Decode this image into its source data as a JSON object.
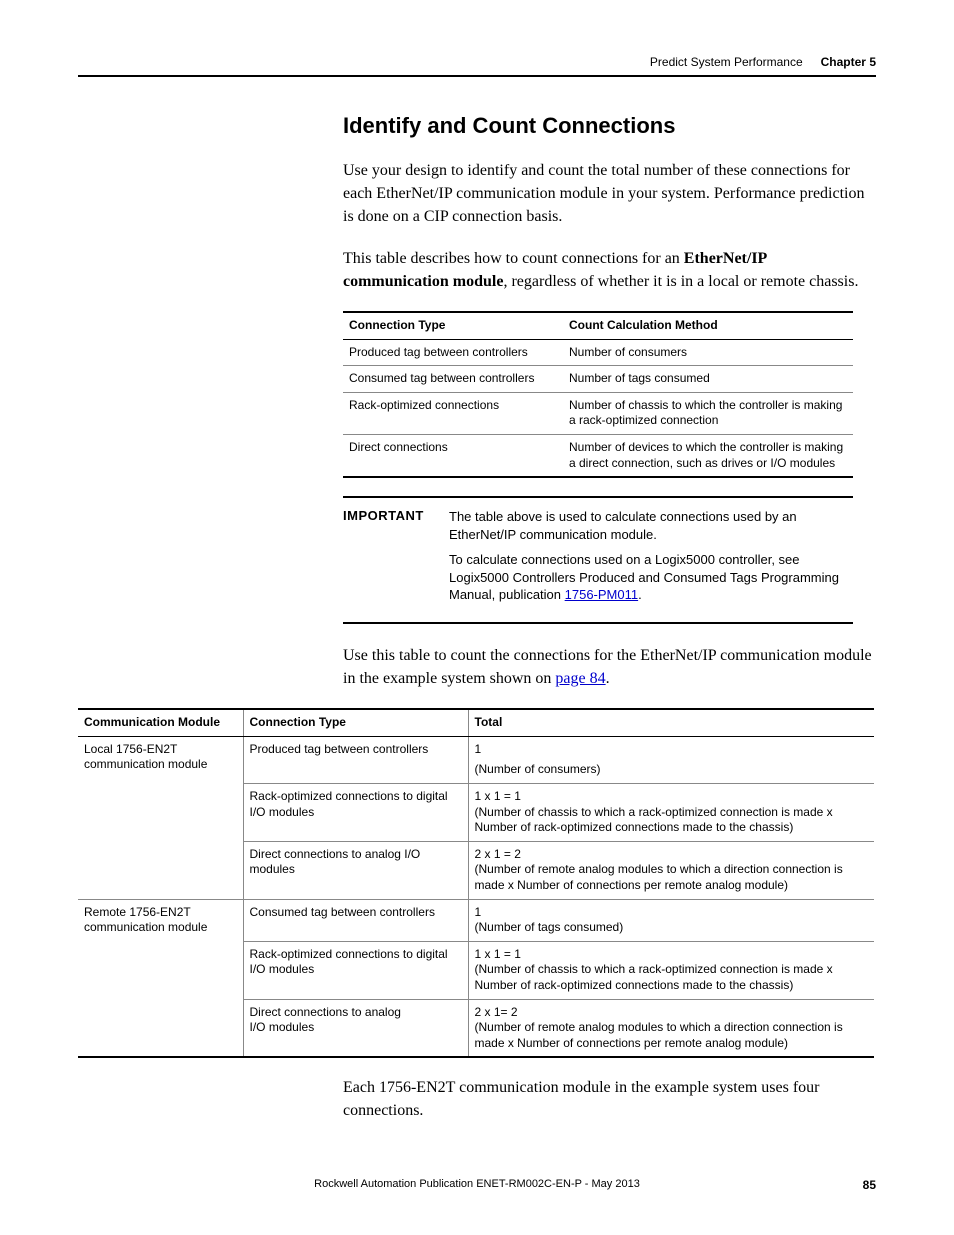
{
  "header": {
    "chapter_title": "Predict System Performance",
    "chapter_label": "Chapter 5"
  },
  "heading": "Identify and Count Connections",
  "para1": "Use your design to identify and count the total number of these connections for each EtherNet/IP communication module in your system. Performance prediction is done on a CIP connection basis.",
  "para2_pre": "This table describes how to count connections for an ",
  "para2_bold": "EtherNet/IP communication module",
  "para2_post": ", regardless of whether it is in a local or remote chassis.",
  "table1": {
    "headers": {
      "c0": "Connection Type",
      "c1": "Count Calculation Method"
    },
    "rows": [
      {
        "c0": "Produced tag between controllers",
        "c1": "Number of consumers"
      },
      {
        "c0": "Consumed tag between controllers",
        "c1": "Number of tags consumed"
      },
      {
        "c0": "Rack-optimized connections",
        "c1": "Number of chassis to which the controller is making a rack-optimized connection"
      },
      {
        "c0": "Direct connections",
        "c1": "Number of devices to which the controller is making a direct connection, such as drives or I/O modules"
      }
    ]
  },
  "important": {
    "label": "IMPORTANT",
    "p1": "The table above is used to calculate connections used by an EtherNet/IP communication module.",
    "p2_pre": "To calculate connections used on a Logix5000 controller, see Logix5000 Controllers Produced and Consumed Tags Programming Manual, publication ",
    "p2_link": "1756-PM011",
    "p2_post": "."
  },
  "para3_pre": "Use this table to count the connections for the EtherNet/IP communication module in the example system shown on ",
  "para3_link": "page 84",
  "para3_post": ".",
  "table2": {
    "headers": {
      "c0": "Communication Module",
      "c1": "Connection Type",
      "c2": "Total"
    },
    "rows": [
      {
        "module": "Local 1756-EN2T communication module",
        "c1": "Produced tag between controllers",
        "c2a": "1",
        "c2b": "(Number of consumers)"
      },
      {
        "c1": "Rack-optimized connections to digital I/O modules",
        "c2a": "1 x 1 = 1",
        "c2b": "(Number of chassis to which a rack-optimized connection is made x Number of rack-optimized connections made to the chassis)"
      },
      {
        "c1": "Direct connections to analog I/O modules",
        "c2a": "2 x 1 = 2",
        "c2b": "(Number of remote analog modules to which a direction connection is made x Number of connections per remote analog module)"
      },
      {
        "module": "Remote 1756-EN2T communication module",
        "c1": "Consumed tag between controllers",
        "c2a": "1",
        "c2b": "(Number of tags consumed)"
      },
      {
        "c1": "Rack-optimized connections to digital I/O modules",
        "c2a": "1 x 1 = 1",
        "c2b": "(Number of chassis to which a rack-optimized connection is made x Number of rack-optimized connections made to the chassis)"
      },
      {
        "c1": "Direct connections to analog I/O modules",
        "c2a": "2 x 1= 2",
        "c2b": "(Number of remote analog modules to which a direction connection is made x Number of connections per remote analog module)"
      }
    ]
  },
  "para4": "Each 1756-EN2T communication module in the example system uses four connections.",
  "footer": {
    "pub": "Rockwell Automation Publication ENET-RM002C-EN-P - May 2013",
    "page": "85"
  }
}
